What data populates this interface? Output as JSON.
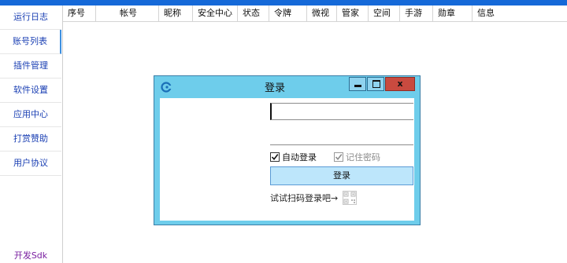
{
  "sidebar": {
    "items": [
      {
        "label": "运行日志"
      },
      {
        "label": "账号列表"
      },
      {
        "label": "插件管理"
      },
      {
        "label": "软件设置"
      },
      {
        "label": "应用中心"
      },
      {
        "label": "打赏赞助"
      },
      {
        "label": "用户协议"
      }
    ],
    "bottom_link": "开发Sdk"
  },
  "table": {
    "columns": [
      "序号",
      "帐号",
      "昵称",
      "安全中心",
      "状态",
      "令牌",
      "微视",
      "管家",
      "空间",
      "手游",
      "勋章",
      "信息"
    ]
  },
  "login_dialog": {
    "title": "登录",
    "close_label": "x",
    "account": {
      "value": "",
      "placeholder": ""
    },
    "password": {
      "value": "",
      "placeholder": ""
    },
    "auto_login": {
      "label": "自动登录",
      "checked": true
    },
    "remember_password": {
      "label": "记住密码",
      "checked": true,
      "disabled": true
    },
    "login_button": "登录",
    "qr_prompt": "试试扫码登录吧→"
  },
  "colors": {
    "topbar": "#1569d8",
    "dialog_frame": "#6ecdeb",
    "close_button": "#c94a3f",
    "login_button": "#bde6fb",
    "sidebar_text": "#1a3fb3",
    "bottom_link": "#7a1fa0"
  }
}
